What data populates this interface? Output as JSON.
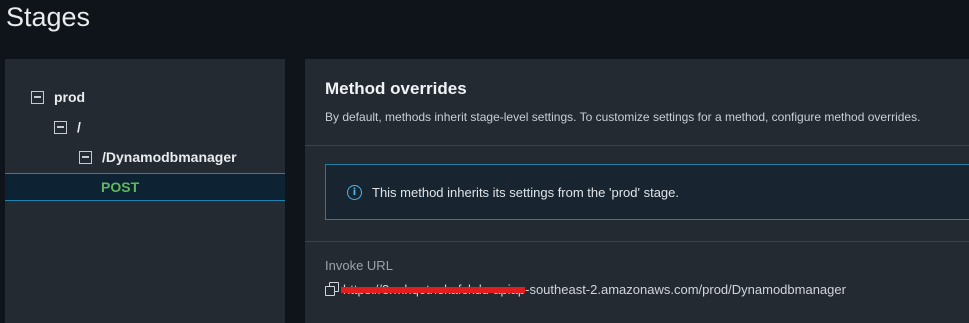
{
  "page": {
    "title": "Stages"
  },
  "tree": {
    "items": [
      {
        "label": "prod",
        "kind": "stage",
        "expanded": true
      },
      {
        "label": "/",
        "kind": "resource",
        "expanded": true
      },
      {
        "label": "/Dynamodbmanager",
        "kind": "resource",
        "expanded": true
      },
      {
        "label": "POST",
        "kind": "method",
        "selected": true
      }
    ]
  },
  "method_overrides": {
    "title": "Method overrides",
    "description": "By default, methods inherit stage-level settings. To customize settings for a method, configure method overrides.",
    "info_message": "This method inherits its settings from the 'prod' stage.",
    "invoke_url_label": "Invoke URL",
    "invoke_url_redacted": "https://3rmhqotnekafckdu-apiap",
    "invoke_url_visible": "-southeast-2.amazonaws.com/prod/Dynamodbmanager"
  },
  "colors": {
    "background": "#0f141a",
    "panel": "#232a31",
    "selected_row": "#0d2233",
    "accent_blue": "#1f83b0",
    "method_green": "#5fb85b",
    "redaction_red": "#e11d1d"
  }
}
